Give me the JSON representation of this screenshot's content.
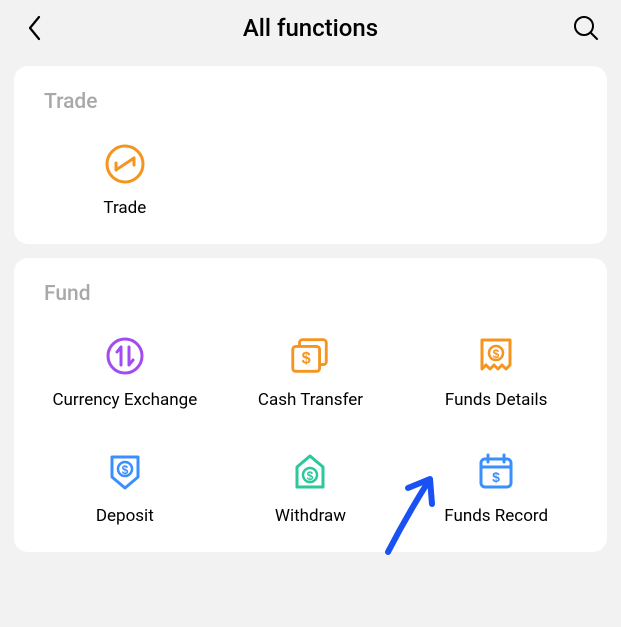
{
  "header": {
    "title": "All functions"
  },
  "sections": {
    "trade": {
      "title": "Trade",
      "items": [
        {
          "label": "Trade"
        }
      ]
    },
    "fund": {
      "title": "Fund",
      "items": [
        {
          "label": "Currency Exchange"
        },
        {
          "label": "Cash Transfer"
        },
        {
          "label": "Funds Details"
        },
        {
          "label": "Deposit"
        },
        {
          "label": "Withdraw"
        },
        {
          "label": "Funds Record"
        }
      ]
    }
  },
  "colors": {
    "orange": "#f5941f",
    "purple": "#a24bf0",
    "blue": "#3a8fff",
    "teal": "#2cc79b",
    "annotation": "#1951f4"
  }
}
